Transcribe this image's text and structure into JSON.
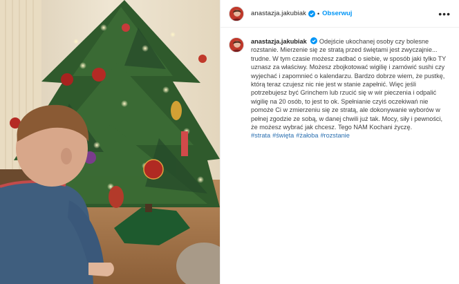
{
  "post": {
    "username": "anastazja.jakubiak",
    "follow_label": "Obserwuj",
    "separator": "•",
    "more_label": "•••",
    "caption": "Odejście ukochanej osoby czy bolesne rozstanie. Mierzenie się ze stratą przed świętami jest zwyczajnie... trudne. W tym czasie możesz zadbać o siebie, w sposób jaki tylko TY uznasz za właściwy. Możesz zbojkotować wigilię i zamówić sushi czy wyjechać i zapomnieć o kalendarzu. Bardzo dobrze wiem, że pustkę, którą teraz czujesz nic nie jest w stanie zapełnić. Więc jeśli potrzebujesz być Grinchem lub rzucić się w wir pieczenia i odpalić wigilię na 20 osób, to jest to ok. Spełnianie czyiś oczekiwań nie pomoże Ci w zmierzeniu się ze stratą, ale dokonywanie wyborów w pełnej zgodzie ze sobą, w danej chwili już tak. Mocy, siły i pewności, że możesz wybrać jak chcesz. Tego NAM Kochani życzę.",
    "hashtags": [
      "#strata",
      "#święta",
      "#żałoba",
      "#rozstanie"
    ]
  },
  "colors": {
    "accent": "#0095f6",
    "hashtag": "#2a6fb0",
    "verified": "#0095f6"
  },
  "icons": {
    "verified": "verified-badge-icon",
    "more": "more-options-icon"
  }
}
